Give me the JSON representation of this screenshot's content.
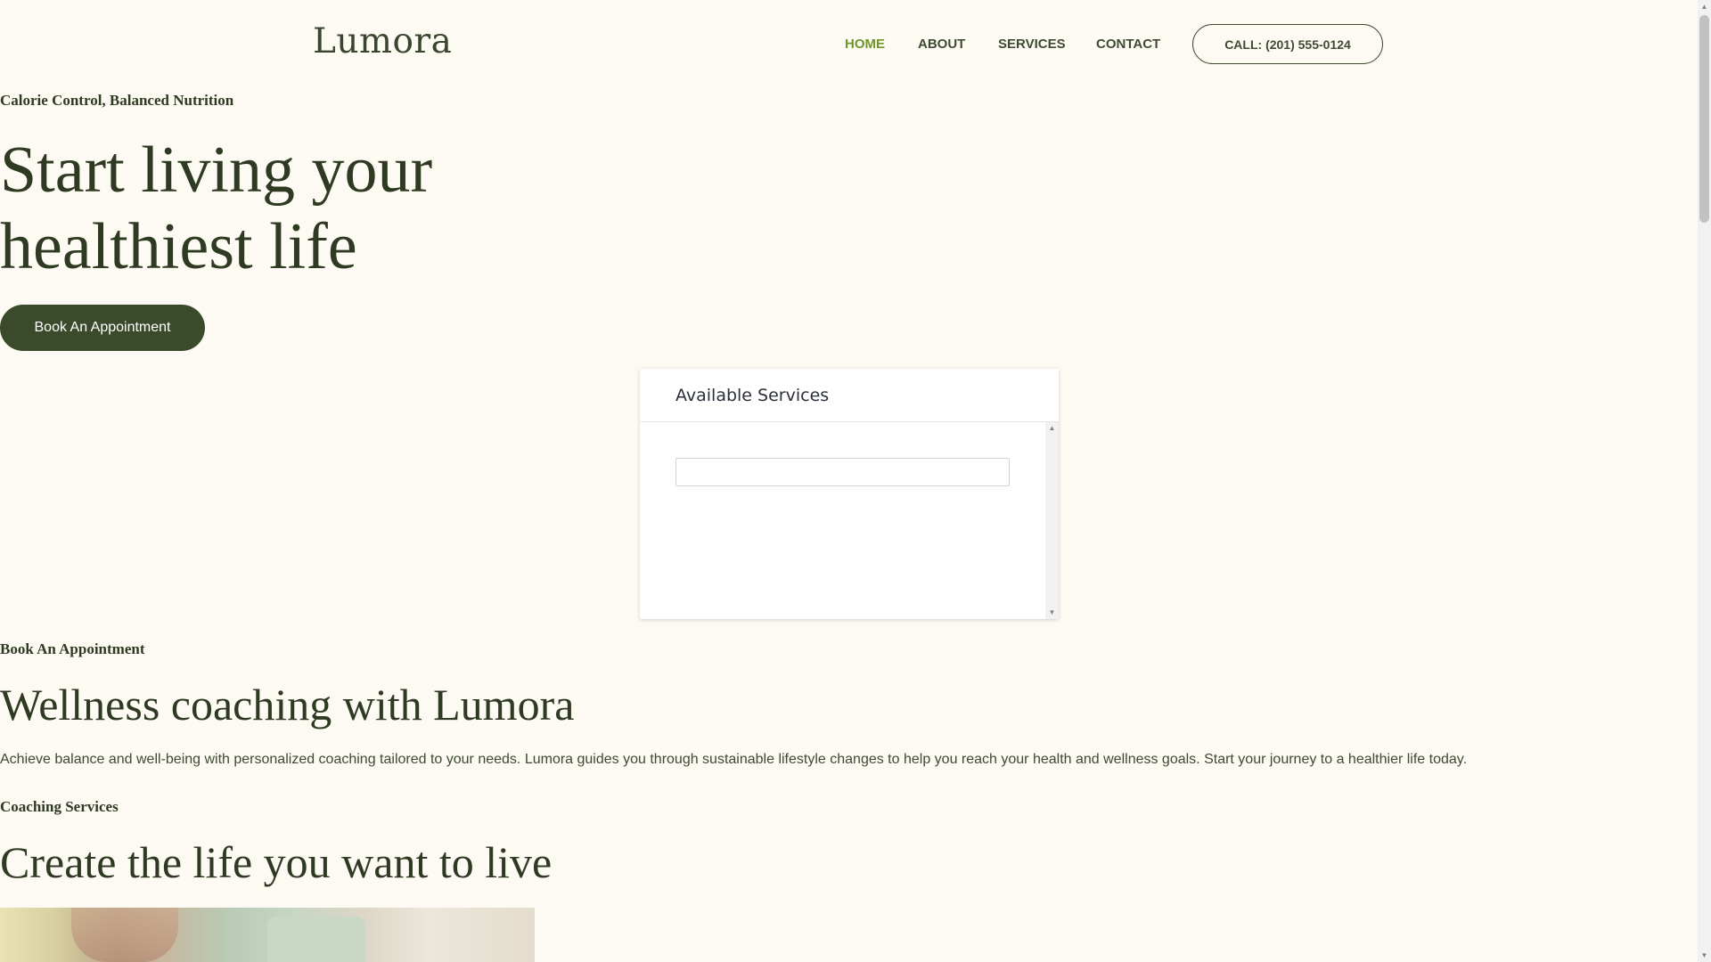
{
  "brand": {
    "logo": "Lumora"
  },
  "nav": {
    "items": [
      {
        "label": "HOME",
        "active": true
      },
      {
        "label": "ABOUT",
        "active": false
      },
      {
        "label": "SERVICES",
        "active": false
      },
      {
        "label": "CONTACT",
        "active": false
      }
    ],
    "call_label": "CALL: (201) 555-0124"
  },
  "hero": {
    "eyebrow": "Calorie Control, Balanced Nutrition",
    "title_line1": "Start living your",
    "title_line2": "healthiest life",
    "cta_label": "Book An Appointment"
  },
  "widget": {
    "title": "Available Services",
    "input_value": ""
  },
  "about": {
    "eyebrow": "Book An Appointment",
    "title": "Wellness coaching with Lumora",
    "body": "Achieve balance and well-being with personalized coaching tailored to your needs. Lumora guides you through sustainable lifestyle changes to help you reach your health and wellness goals. Start your journey to a healthier life today."
  },
  "services": {
    "eyebrow": "Coaching Services",
    "title": "Create the life you want to live"
  },
  "colors": {
    "background": "#fcfaf3",
    "dark_green": "#3c4a2c",
    "accent_green": "#6f9628"
  },
  "icons": {
    "scroll_up": "scroll-up-arrow-icon",
    "scroll_down": "scroll-down-arrow-icon"
  }
}
